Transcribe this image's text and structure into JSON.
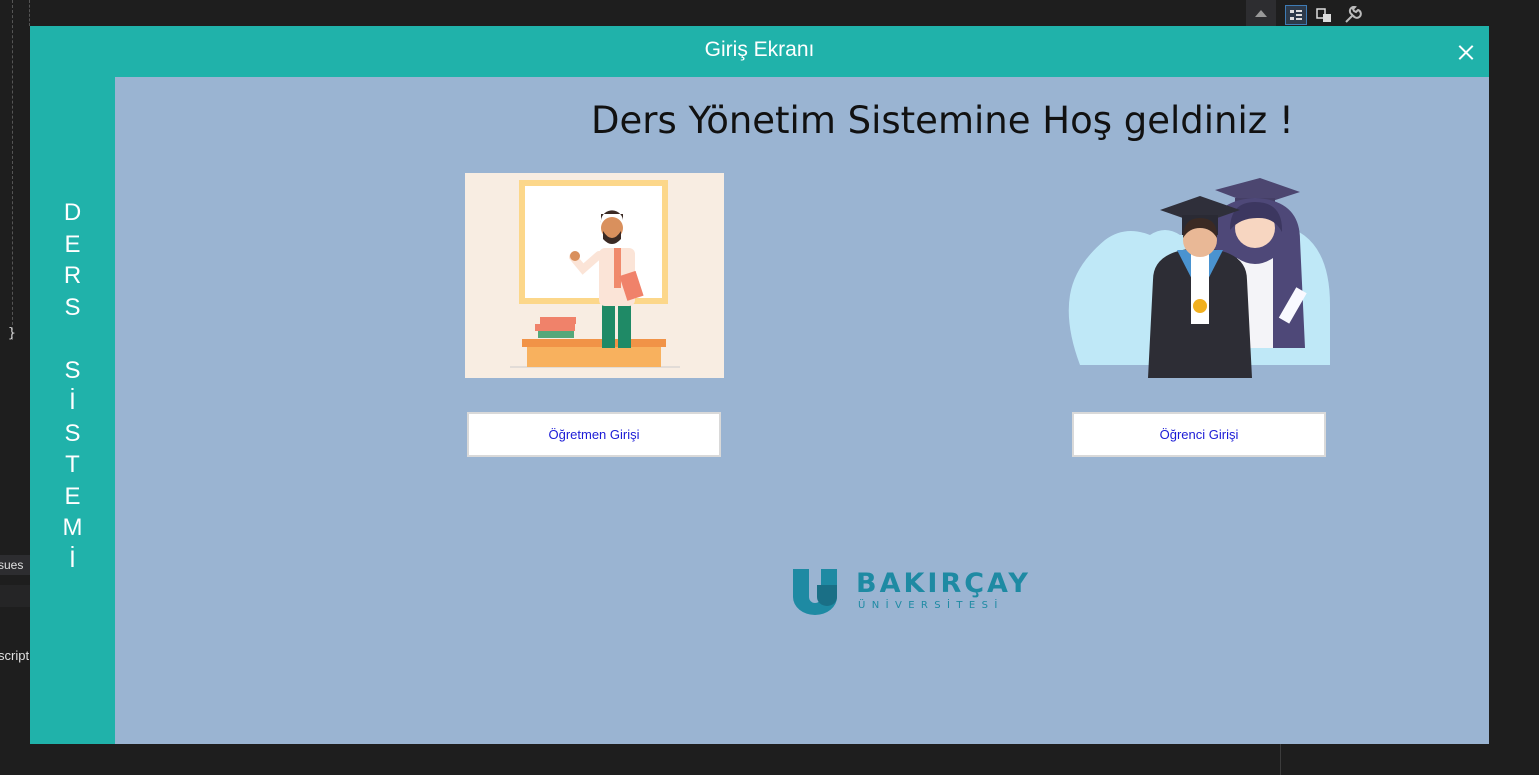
{
  "window": {
    "title": "Giriş Ekranı"
  },
  "side_panel": {
    "vertical_text": "D\nE\nR\nS\n \nS\nİ\nS\nT\nE\nM\nİ"
  },
  "main": {
    "welcome_text": "Ders Yönetim Sistemine Hoş geldiniz !",
    "teacher_button_label": "Öğretmen Girişi",
    "student_button_label": "Öğrenci Girişi"
  },
  "logo": {
    "name": "BAKIRÇAY",
    "subtitle": "ÜNİVERSİTESİ"
  },
  "ide_background": {
    "issues_fragment": "sues",
    "script_fragment": "script",
    "brace": "}"
  },
  "colors": {
    "title_bar": "#20b2aa",
    "content_bg": "#9ab4d2",
    "button_text": "#1b1bd6",
    "logo": "#1e8aa3"
  }
}
